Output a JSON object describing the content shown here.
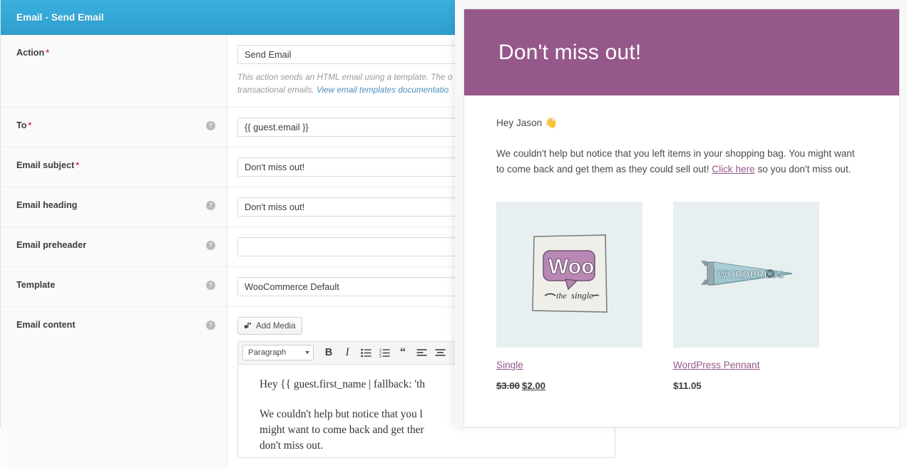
{
  "form": {
    "title": "Email - Send Email",
    "rows": [
      {
        "label": "Action",
        "required": true,
        "has_help": false,
        "value": "Send Email",
        "description_part1": "This action sends an HTML email using a template. The o",
        "description_part2": "transactional emails. ",
        "description_link": "View email templates documentatio"
      },
      {
        "label": "To",
        "required": true,
        "has_help": true,
        "value": "{{ guest.email }}"
      },
      {
        "label": "Email subject",
        "required": true,
        "has_help": false,
        "value": "Don't miss out!"
      },
      {
        "label": "Email heading",
        "required": false,
        "has_help": true,
        "value": "Don't miss out!"
      },
      {
        "label": "Email preheader",
        "required": false,
        "has_help": true,
        "value": ""
      },
      {
        "label": "Template",
        "required": false,
        "has_help": true,
        "value": "WooCommerce Default"
      },
      {
        "label": "Email content",
        "required": false,
        "has_help": true
      }
    ],
    "editor": {
      "add_media_label": "Add Media",
      "format_select": "Paragraph",
      "toolbar_buttons": [
        {
          "name": "bold-button",
          "glyph": "B"
        },
        {
          "name": "italic-button",
          "glyph": "I"
        },
        {
          "name": "unordered-list-button",
          "glyph": ""
        },
        {
          "name": "ordered-list-button",
          "glyph": ""
        },
        {
          "name": "blockquote-button",
          "glyph": "“"
        },
        {
          "name": "align-left-button",
          "glyph": ""
        },
        {
          "name": "align-center-button",
          "glyph": ""
        }
      ],
      "content_line1": "Hey {{ guest.first_name | fallback: 'th",
      "content_line2": "We couldn't help but notice that you l",
      "content_line3": "might want to come back and get ther",
      "content_line4": "don't miss out."
    }
  },
  "email_preview": {
    "heading": "Don't miss out!",
    "heading_bg": "#96588a",
    "greeting": "Hey Jason ",
    "greeting_emoji": "👋",
    "body_before_link": "We couldn't help but notice that you left items in your shopping bag. You might want to come back and get them as they could sell out! ",
    "body_link": "Click here",
    "body_after_link": " so you don't miss out.",
    "products": [
      {
        "name": "Single",
        "image_alt": "woo-the-single-album-sketch",
        "price_old": "$3.00",
        "price_new": "$2.00",
        "price_single": ""
      },
      {
        "name": "WordPress Pennant",
        "image_alt": "wordpress-pennant-flag",
        "price_old": "",
        "price_new": "",
        "price_single": "$11.05"
      }
    ]
  }
}
